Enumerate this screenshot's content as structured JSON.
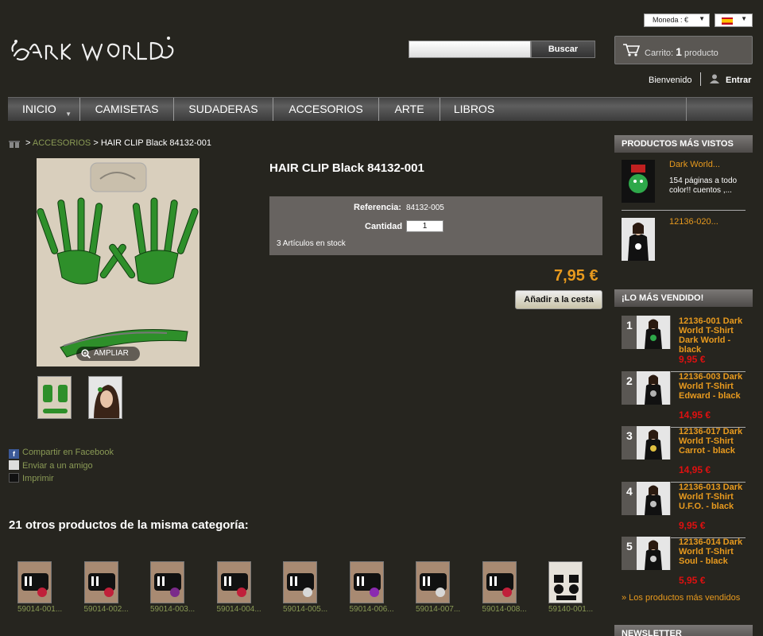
{
  "topbar": {
    "currency": "Moneda : €",
    "language_flag": "spain-flag"
  },
  "search": {
    "placeholder": "",
    "button": "Buscar"
  },
  "cart": {
    "label": "Carrito:",
    "count": "1",
    "unit": "producto"
  },
  "user": {
    "welcome": "Bienvenido",
    "login": "Entrar"
  },
  "nav": [
    "INICIO",
    "CAMISETAS",
    "SUDADERAS",
    "ACCESORIOS",
    "ARTE",
    "LIBROS"
  ],
  "breadcrumb": {
    "sep1": ">",
    "category": "ACCESORIOS",
    "sep2": ">",
    "current": "HAIR CLIP Black 84132-001"
  },
  "product": {
    "title": "HAIR CLIP Black 84132-001",
    "ref_label": "Referencia:",
    "ref_value": "84132-005",
    "qty_label": "Cantidad",
    "qty_value": "1",
    "stock": "3 Artículos en stock",
    "price": "7,95 €",
    "add_to_cart": "Añadir a la cesta",
    "zoom": "AMPLIAR"
  },
  "share": {
    "facebook": "Compartir en Facebook",
    "friend": "Enviar a un amigo",
    "print": "Imprimir"
  },
  "others": {
    "title": "21 otros productos de la misma categoría:",
    "items": [
      "59014-001...",
      "59014-002...",
      "59014-003...",
      "59014-004...",
      "59014-005...",
      "59014-006...",
      "59014-007...",
      "59014-008...",
      "59140-001..."
    ]
  },
  "most_viewed": {
    "title": "PRODUCTOS MÁS VISTOS",
    "items": [
      {
        "name": "Dark World...",
        "desc": "154 páginas a todo color!! cuentos ,..."
      },
      {
        "name": "12136-020...",
        "desc": ""
      }
    ]
  },
  "bestsellers": {
    "title": "¡LO MÁS VENDIDO!",
    "items": [
      {
        "rank": "1",
        "name": "12136-001 Dark World T-Shirt Dark World - black",
        "price": "9,95 €"
      },
      {
        "rank": "2",
        "name": "12136-003 Dark World T-Shirt Edward - black",
        "price": "14,95 €"
      },
      {
        "rank": "3",
        "name": "12136-017 Dark World T-Shirt Carrot - black",
        "price": "14,95 €"
      },
      {
        "rank": "4",
        "name": "12136-013 Dark World T-Shirt U.F.O. - black",
        "price": "9,95 €"
      },
      {
        "rank": "5",
        "name": "12136-014 Dark World T-Shirt Soul - black",
        "price": "5,95 €"
      }
    ],
    "more": "» Los productos más vendidos"
  },
  "newsletter": {
    "title": "NEWSLETTER"
  },
  "colors": {
    "background": "#26251f",
    "accent_orange": "#e89a1e",
    "link_green": "#8a9a55",
    "price_red": "#e01010"
  }
}
